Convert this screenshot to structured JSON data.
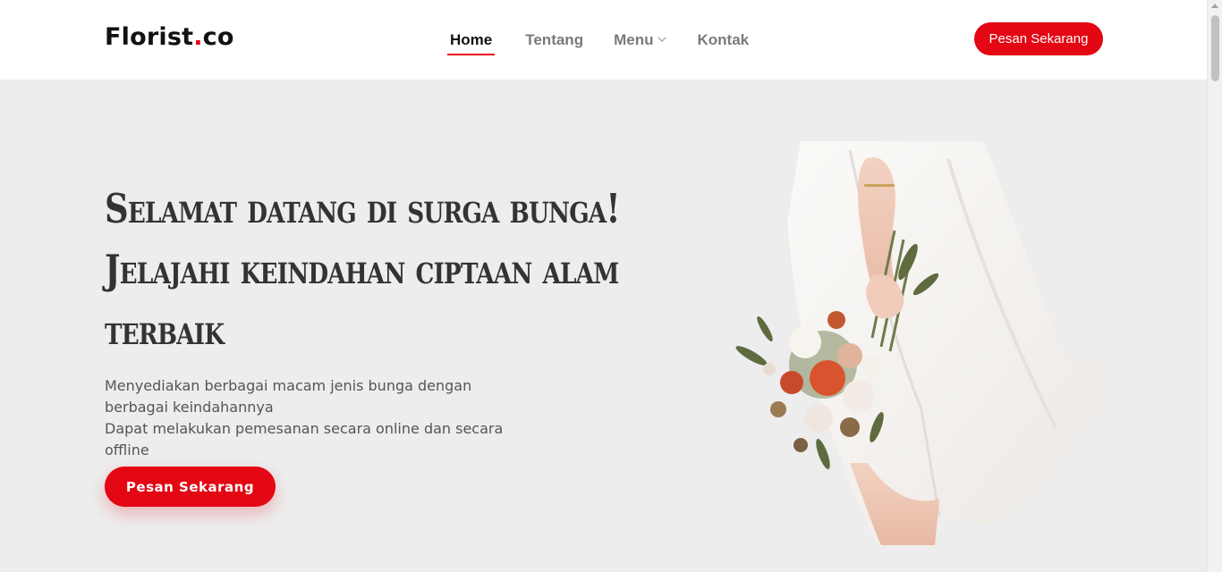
{
  "header": {
    "logo_main": "Florist",
    "logo_dot": ".",
    "logo_tld": "co",
    "nav": [
      {
        "label": "Home",
        "active": true
      },
      {
        "label": "Tentang"
      },
      {
        "label": "Menu",
        "has_dropdown": true
      },
      {
        "label": "Kontak"
      }
    ],
    "cta_label": "Pesan Sekarang"
  },
  "hero": {
    "title_lines": [
      "Selamat datang di surga bunga!",
      "Jelajahi keindahan ciptaan alam",
      "terbaik"
    ],
    "description_lines": [
      "Menyediakan berbagai macam jenis bunga dengan berbagai keindahannya",
      "Dapat melakukan pemesanan secara online dan secara offline"
    ],
    "cta_label": "Pesan Sekarang",
    "image_icon": "woman-with-bouquet-image"
  },
  "colors": {
    "accent": "#e30613",
    "background": "#ededed",
    "header_bg": "#ffffff",
    "text_dark": "#111111",
    "text_muted": "#7a7a7a"
  }
}
